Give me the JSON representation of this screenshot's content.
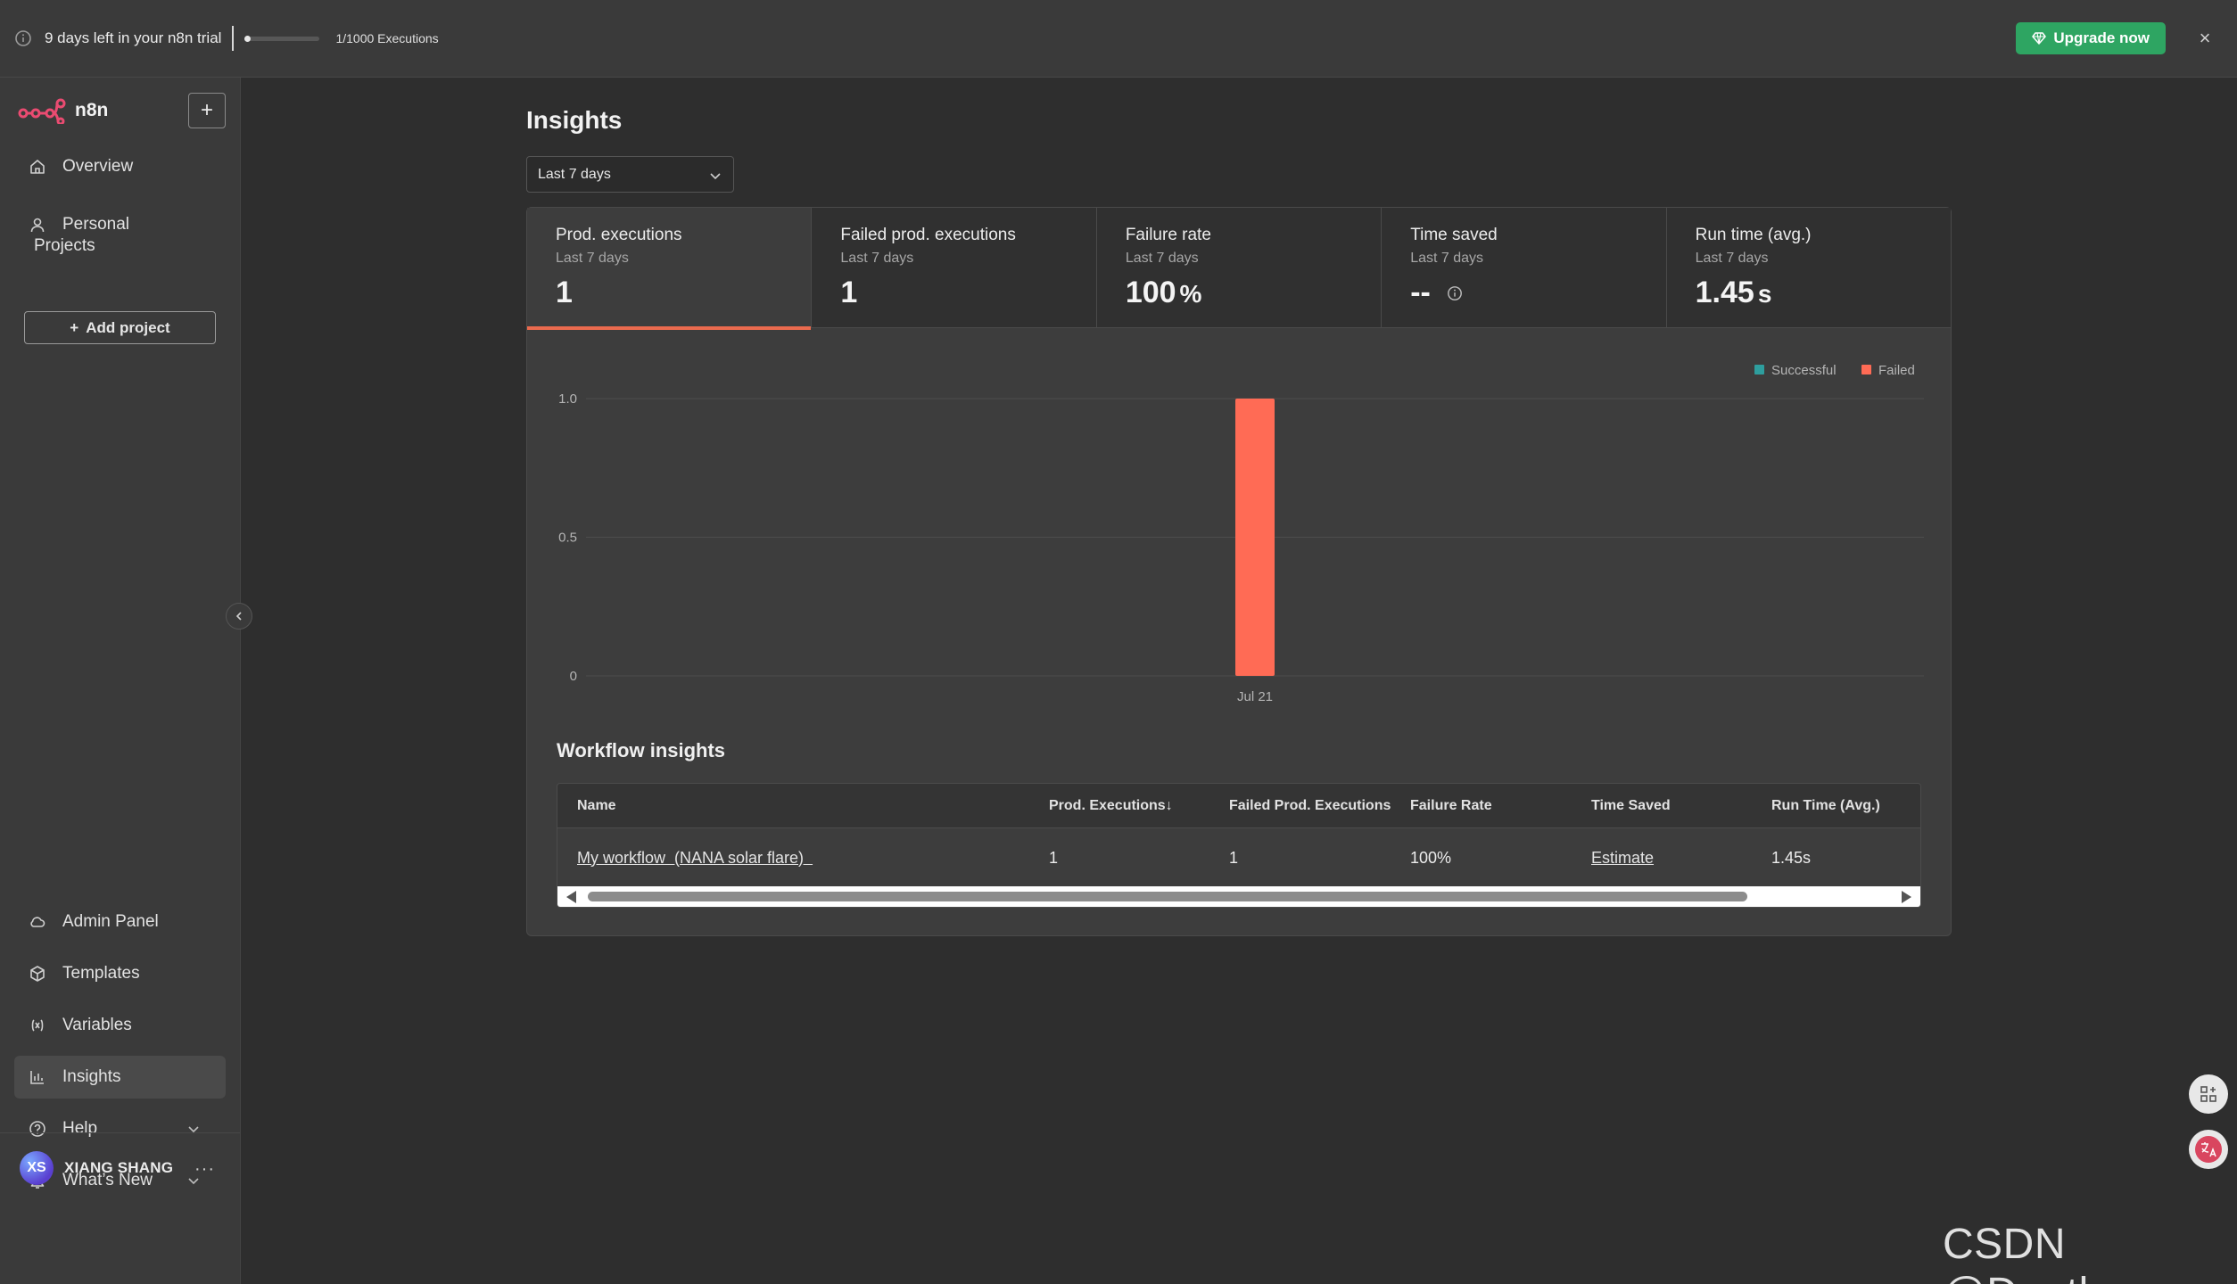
{
  "banner": {
    "trial_text": "9 days left in your n8n trial",
    "executions_text": "1/1000 Executions",
    "executions_used_fraction": 0.001,
    "upgrade_label": "Upgrade now",
    "close_glyph": "×",
    "upgrade_color": "#2ea562"
  },
  "sidebar": {
    "brand": "n8n",
    "new_glyph": "+",
    "top_items": [
      {
        "label": "Overview",
        "icon": "home-icon"
      },
      {
        "label": "Personal",
        "icon": "user-icon"
      }
    ],
    "projects_heading": "Projects",
    "add_project_label": "Add project",
    "bottom_items": [
      {
        "label": "Admin Panel",
        "icon": "cloud-icon"
      },
      {
        "label": "Templates",
        "icon": "box-icon"
      },
      {
        "label": "Variables",
        "icon": "variable-icon"
      },
      {
        "label": "Insights",
        "icon": "bar-chart-icon",
        "active": true
      },
      {
        "label": "Help",
        "icon": "help-circle-icon"
      },
      {
        "label": "What’s New",
        "icon": "bell-icon"
      }
    ],
    "user": {
      "initials": "XS",
      "name": "XIANG SHANG",
      "more_glyph": "···"
    }
  },
  "main": {
    "title": "Insights",
    "range_value": "Last 7 days",
    "kpis": [
      {
        "title": "Prod. executions",
        "sub": "Last 7 days",
        "value": "1",
        "unit": ""
      },
      {
        "title": "Failed prod. executions",
        "sub": "Last 7 days",
        "value": "1",
        "unit": ""
      },
      {
        "title": "Failure rate",
        "sub": "Last 7 days",
        "value": "100",
        "unit": "%"
      },
      {
        "title": "Time saved",
        "sub": "Last 7 days",
        "value": "--",
        "unit": ""
      },
      {
        "title": "Run time (avg.)",
        "sub": "Last 7 days",
        "value": "1.45",
        "unit": "s"
      }
    ],
    "workflow_title": "Workflow insights",
    "table": {
      "headers": [
        "Name",
        "Prod. Executions",
        "Failed Prod. Executions",
        "Failure Rate",
        "Time Saved",
        "Run Time (Avg.)"
      ],
      "sort_glyph": "↓",
      "rows": [
        [
          "My workflow  (NANA solar flare)  ",
          "1",
          "1",
          "100%",
          "Estimate",
          "1.45s"
        ]
      ]
    }
  },
  "chart_data": {
    "type": "bar",
    "categories": [
      "Jul 21"
    ],
    "series": [
      {
        "name": "Successful",
        "values": [
          0
        ],
        "color": "#2e9e9e"
      },
      {
        "name": "Failed",
        "values": [
          1
        ],
        "color": "#ff6b55"
      }
    ],
    "stacked": true,
    "ylim": [
      0,
      1
    ],
    "yticks": [
      "0",
      "0.5",
      "1.0"
    ],
    "grid": true,
    "legend_position": "top-right"
  },
  "watermark": "CSDN @Dontla"
}
